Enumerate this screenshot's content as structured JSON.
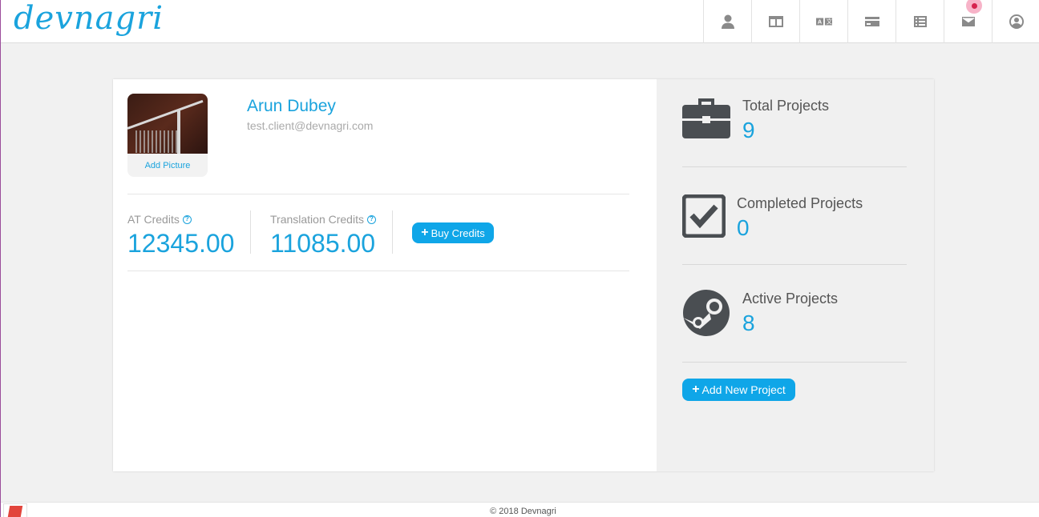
{
  "header": {
    "logo_text": "devnagri",
    "nav_icons": [
      "user-icon",
      "columns-icon",
      "translate-icon",
      "credit-card-icon",
      "list-icon",
      "mail-icon",
      "account-circle-icon"
    ]
  },
  "profile": {
    "name": "Arun Dubey",
    "email": "test.client@devnagri.com",
    "add_picture_label": "Add Picture"
  },
  "credits": {
    "at_label": "AT Credits",
    "at_value": "12345.00",
    "translation_label": "Translation Credits",
    "translation_value": "11085.00",
    "buy_label": "Buy Credits"
  },
  "stats": {
    "total_label": "Total Projects",
    "total_value": "9",
    "completed_label": "Completed Projects",
    "completed_value": "0",
    "active_label": "Active Projects",
    "active_value": "8",
    "add_project_label": "Add New Project"
  },
  "footer": {
    "copyright": "© 2018 Devnagri"
  },
  "colors": {
    "accent": "#1aa3dd",
    "button": "#0fa6e8",
    "notification": "#d6224e"
  }
}
